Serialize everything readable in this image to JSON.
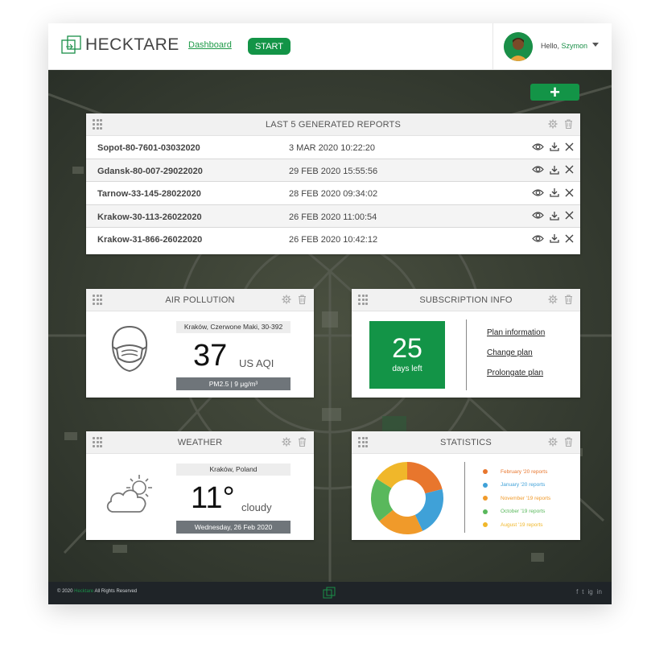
{
  "header": {
    "logo_text": "HECKTARE",
    "nav_dashboard": "Dashboard",
    "start_label": "START",
    "greeting_prefix": "Hello, ",
    "user_name": "Szymon"
  },
  "add_button_label": "+",
  "reports": {
    "title": "LAST 5 GENERATED REPORTS",
    "rows": [
      {
        "name": "Sopot-80-7601-03032020",
        "date": "3 MAR 2020  10:22:20"
      },
      {
        "name": "Gdansk-80-007-29022020",
        "date": "29 FEB 2020  15:55:56"
      },
      {
        "name": "Tarnow-33-145-28022020",
        "date": "28 FEB 2020  09:34:02"
      },
      {
        "name": "Krakow-30-113-26022020",
        "date": "26 FEB 2020 11:00:54"
      },
      {
        "name": "Krakow-31-866-26022020",
        "date": "26 FEB 2020 10:42:12"
      }
    ]
  },
  "air": {
    "title": "AIR POLLUTION",
    "location": "Kraków, Czerwone Maki, 30-392",
    "value": "37",
    "unit": "US AQI",
    "detail": "PM2.5 | 9 μg/m³"
  },
  "subscription": {
    "title": "SUBSCRIPTION INFO",
    "days": "25",
    "days_label": "days left",
    "links": [
      "Plan information",
      "Change plan",
      "Prolongate plan"
    ]
  },
  "weather": {
    "title": "WEATHER",
    "location": "Kraków, Poland",
    "temp": "11°",
    "condition": "cloudy",
    "date": "Wednesday, 26 Feb 2020"
  },
  "statistics": {
    "title": "STATISTICS"
  },
  "chart_data": {
    "type": "pie",
    "categories": [
      "February '20 reports",
      "January '20 reports",
      "November '19 reports",
      "October '19 reports",
      "August '19 reports"
    ],
    "values": [
      21,
      22,
      21,
      20,
      16
    ],
    "colors": [
      "#e8762d",
      "#3fa1d8",
      "#f09a2a",
      "#59b85c",
      "#f0b72a"
    ],
    "donut": true,
    "legend": "right"
  },
  "footer": {
    "copyright_prefix": "© 2020 ",
    "brand": "Hecktare",
    "copyright_suffix": " All Rights Reserved",
    "social": [
      "f",
      "t",
      "ig",
      "in"
    ]
  },
  "colors": {
    "brand_green": "#139447",
    "footer_bg": "#1f2428"
  }
}
